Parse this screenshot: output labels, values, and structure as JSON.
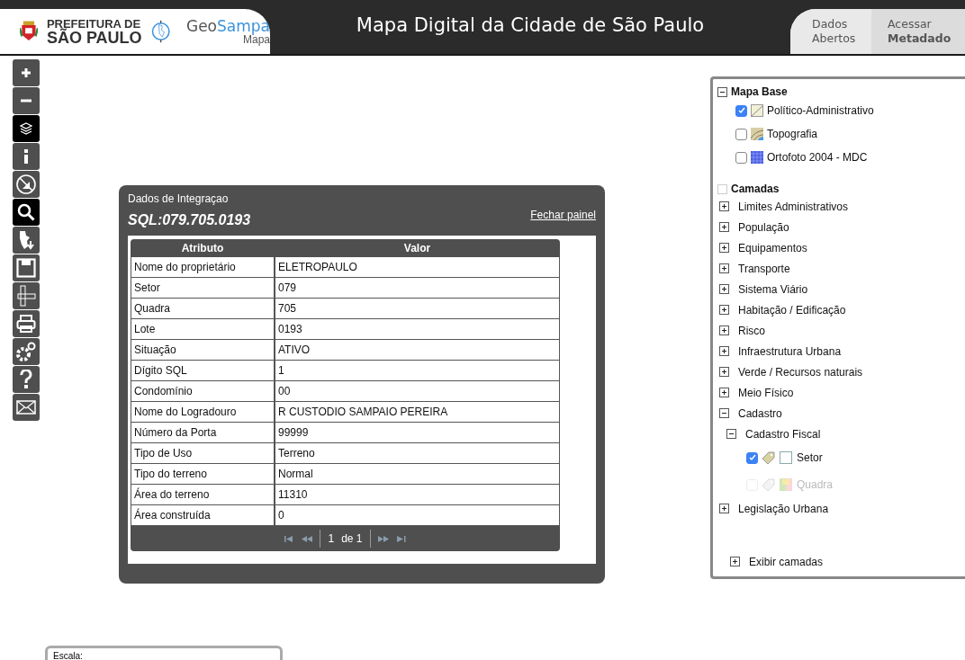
{
  "header": {
    "org_line1": "PREFEITURA DE",
    "org_line2": "SÃO PAULO",
    "brand_a": "Geo",
    "brand_b": "Sampa",
    "brand_sub": "Mapa",
    "title": "Mapa Digital da Cidade de São Paulo",
    "nav": [
      {
        "label": "Dados Abertos"
      },
      {
        "label": "Acessar **Metadado**"
      }
    ]
  },
  "tools": [
    {
      "kind": "zoom-in",
      "selected": false
    },
    {
      "kind": "zoom-out",
      "selected": false
    },
    {
      "kind": "layers",
      "selected": true
    },
    {
      "kind": "info",
      "selected": false
    },
    {
      "kind": "no-draw",
      "selected": false
    },
    {
      "kind": "search",
      "selected": true
    },
    {
      "kind": "download",
      "selected": false
    },
    {
      "kind": "save",
      "selected": false
    },
    {
      "kind": "measure",
      "selected": false
    },
    {
      "kind": "print",
      "selected": false
    },
    {
      "kind": "settings",
      "selected": false
    },
    {
      "kind": "help",
      "selected": false
    },
    {
      "kind": "mail",
      "selected": false
    }
  ],
  "info_panel": {
    "title": "Dados de Integraçao",
    "close_link": "Fechar painel",
    "sql": "SQL:079.705.0193",
    "columns": [
      "Atributo",
      "Valor"
    ],
    "rows": [
      [
        "Nome do proprietário",
        "ELETROPAULO"
      ],
      [
        "Setor",
        "079"
      ],
      [
        "Quadra",
        "705"
      ],
      [
        "Lote",
        "0193"
      ],
      [
        "Situação",
        "ATIVO"
      ],
      [
        "Dígito SQL",
        "1"
      ],
      [
        "Condomínio",
        "00"
      ],
      [
        "Nome do Logradouro",
        "R CUSTODIO SAMPAIO PEREIRA"
      ],
      [
        "Número da Porta",
        "99999"
      ],
      [
        "Tipo de Uso",
        "Terreno"
      ],
      [
        "Tipo do terreno",
        "Normal"
      ],
      [
        "Área do terreno",
        "11310"
      ],
      [
        "Área construída",
        "0"
      ]
    ],
    "pager": {
      "page": "1",
      "of": "de 1"
    }
  },
  "layers": {
    "base": {
      "title": "Mapa Base",
      "expanded": true,
      "items": [
        {
          "label": "Político-Administrativo",
          "kind": "lines",
          "checked": true
        },
        {
          "label": "Topografia",
          "kind": "topo",
          "checked": false
        },
        {
          "label": "Ortofoto 2004 - MDC",
          "kind": "ortho",
          "checked": false
        }
      ]
    },
    "camadas": {
      "title": "Camadas",
      "groups": [
        {
          "label": "Limites Administrativos",
          "expanded": false
        },
        {
          "label": "População",
          "expanded": false
        },
        {
          "label": "Equipamentos",
          "expanded": false
        },
        {
          "label": "Transporte",
          "expanded": false
        },
        {
          "label": "Sistema Viário",
          "expanded": false
        },
        {
          "label": "Habitação / Edificação",
          "expanded": false
        },
        {
          "label": "Risco",
          "expanded": false
        },
        {
          "label": "Infraestrutura Urbana",
          "expanded": false
        },
        {
          "label": "Verde / Recursos naturais",
          "expanded": false
        },
        {
          "label": "Meio Físico",
          "expanded": false
        },
        {
          "label": "Cadastro",
          "expanded": true,
          "children": [
            {
              "label": "Cadastro Fiscal",
              "expanded": true,
              "layers": [
                {
                  "label": "Setor",
                  "kind": "outline",
                  "checked": true,
                  "disabled": false
                },
                {
                  "label": "Quadra",
                  "kind": "blocks",
                  "checked": false,
                  "disabled": true
                }
              ]
            }
          ]
        },
        {
          "label": "Legislação Urbana",
          "expanded": false
        }
      ]
    },
    "footer": {
      "label": "Exibir camadas",
      "expanded": false
    }
  },
  "scale": {
    "label": "Escala:"
  }
}
